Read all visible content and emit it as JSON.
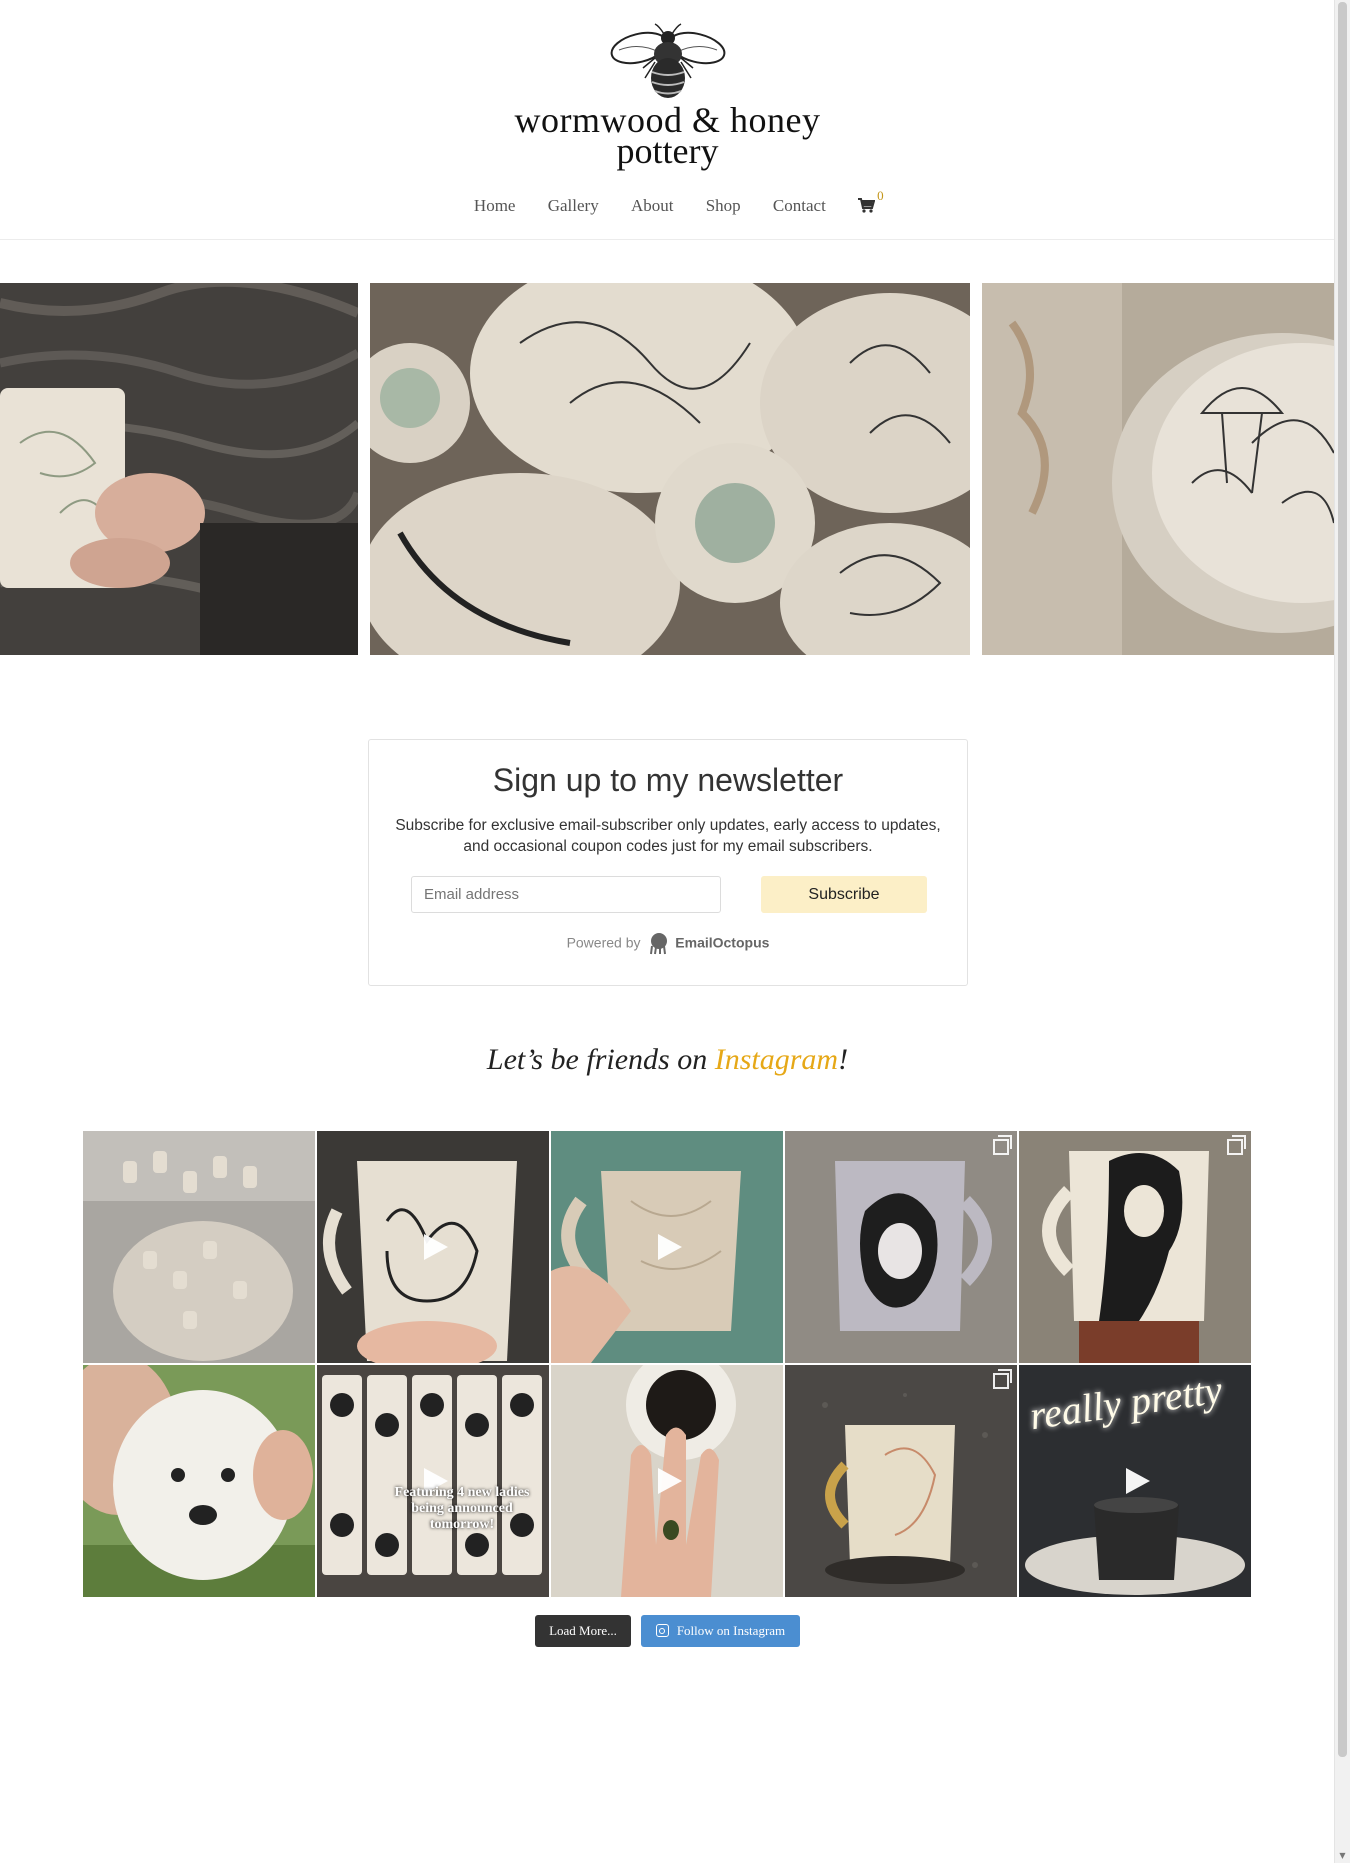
{
  "header": {
    "logo_line1": "wormwood & honey",
    "logo_line2": "pottery",
    "logo_icon": "bee-icon",
    "nav": [
      "Home",
      "Gallery",
      "About",
      "Shop",
      "Contact"
    ],
    "cart_icon": "cart-icon",
    "cart_count": "0"
  },
  "newsletter": {
    "title": "Sign up to my newsletter",
    "description": "Subscribe for exclusive email-subscriber only updates, early access to updates, and occasional coupon codes just for my email subscribers.",
    "email_placeholder": "Email address",
    "subscribe_label": "Subscribe",
    "powered_by": "Powered by",
    "brand": "EmailOctopus"
  },
  "instagram": {
    "heading_pre": "Let’s be friends on ",
    "heading_link": "Instagram",
    "heading_post": "!",
    "tiles": [
      {
        "kind": "image"
      },
      {
        "kind": "video"
      },
      {
        "kind": "video"
      },
      {
        "kind": "carousel"
      },
      {
        "kind": "carousel"
      },
      {
        "kind": "carousel"
      },
      {
        "kind": "video",
        "caption": "Featuring 4 new ladies being announced tomorrow!"
      },
      {
        "kind": "video"
      },
      {
        "kind": "carousel"
      },
      {
        "kind": "video",
        "caption": "really pretty"
      }
    ],
    "load_more_label": "Load More...",
    "follow_label": "Follow on Instagram"
  },
  "colors": {
    "accent": "#e6a817",
    "subscribe_bg": "#fcefc7",
    "follow_bg": "#4b8ed1",
    "load_bg": "#333333"
  }
}
